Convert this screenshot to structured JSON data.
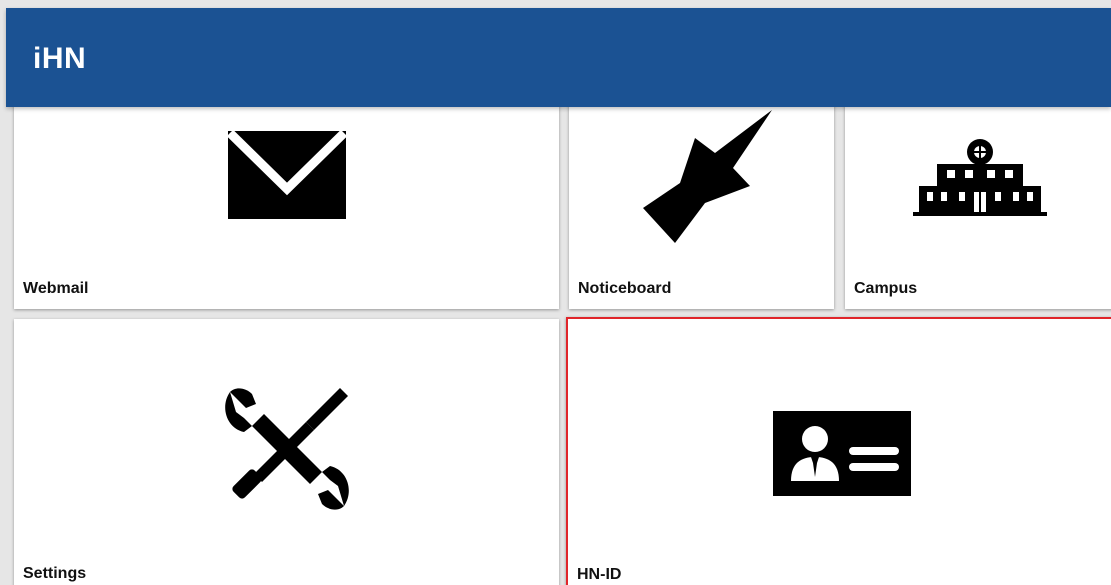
{
  "app": {
    "title": "iHN",
    "accent_color": "#1b5293",
    "selected_border_color": "#e0262b"
  },
  "tiles": [
    {
      "label": "Webmail",
      "icon": "envelope-icon",
      "selected": false
    },
    {
      "label": "Noticeboard",
      "icon": "pushpin-icon",
      "selected": false
    },
    {
      "label": "Campus",
      "icon": "building-icon",
      "selected": false
    },
    {
      "label": "Settings",
      "icon": "wrench-screwdriver-icon",
      "selected": false
    },
    {
      "label": "HN-ID",
      "icon": "id-card-icon",
      "selected": true
    }
  ]
}
